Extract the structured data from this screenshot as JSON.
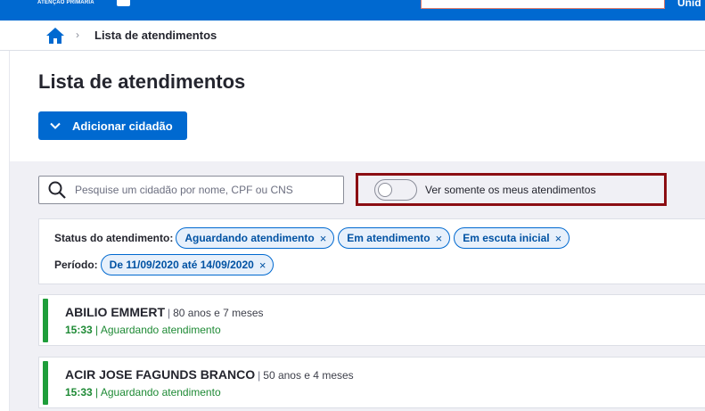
{
  "header": {
    "brand": "ATENÇÃO PRIMÁRIA",
    "unit_label": "Unid"
  },
  "breadcrumb": {
    "current": "Lista de atendimentos"
  },
  "page": {
    "title": "Lista de atendimentos",
    "add_button_label": "Adicionar cidadão"
  },
  "search": {
    "placeholder": "Pesquise um cidadão por nome, CPF ou CNS",
    "value": ""
  },
  "toggle": {
    "label": "Ver somente os meus atendimentos",
    "checked": false
  },
  "filters": {
    "status_label": "Status do atendimento:",
    "status_chips": [
      "Aguardando atendimento",
      "Em atendimento",
      "Em escuta inicial"
    ],
    "period_label": "Período:",
    "period_chip": "De 11/09/2020 até 14/09/2020",
    "remove_glyph": "×"
  },
  "patients": [
    {
      "name": "ABILIO EMMERT",
      "age": "80 anos e 7 meses",
      "time": "15:33",
      "status": "Aguardando atendimento"
    },
    {
      "name": "ACIR JOSE FAGUNDS BRANCO",
      "age": "50 anos e 4 meses",
      "time": "15:33",
      "status": "Aguardando atendimento"
    }
  ],
  "colors": {
    "primary": "#0069d0",
    "status_waiting": "#1e9e3a",
    "highlight_border": "#8b0d12"
  },
  "icons": {
    "home": "home-icon",
    "breadcrumb_separator": "chevron-right-icon",
    "add": "chevron-down-icon",
    "search": "search-icon"
  }
}
